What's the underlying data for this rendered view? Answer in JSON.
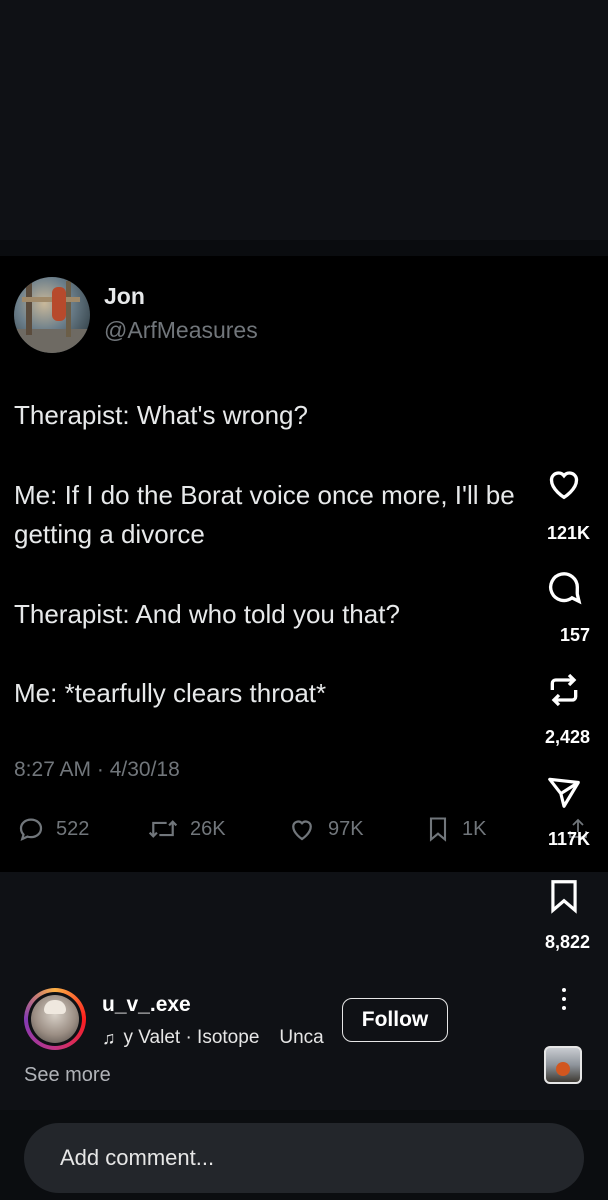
{
  "tweet": {
    "author_name": "Jon",
    "author_handle": "@ArfMeasures",
    "lines": [
      "Therapist: What's wrong?",
      "Me: If I do the Borat voice once more, I'll be",
      "getting a divorce",
      "Therapist: And who told you that?",
      "Me: *tearfully clears throat*"
    ],
    "timestamp": "8:27 AM · 4/30/18",
    "stats": {
      "replies": "522",
      "retweets": "26K",
      "likes": "97K",
      "bookmarks": "1K"
    }
  },
  "rail": {
    "likes": "121K",
    "comments": "157",
    "reposts": "2,428",
    "shares": "117K",
    "saves": "8,822"
  },
  "reel": {
    "username": "u_v_.exe",
    "music": "y Valet · Isotope",
    "music_extra": "Unca",
    "follow_label": "Follow",
    "see_more": "See more"
  },
  "comment": {
    "placeholder": "Add comment..."
  },
  "icons": {
    "like": "heart-icon",
    "comment": "speech-bubble-icon",
    "repost": "repost-icon",
    "share": "send-icon",
    "save": "bookmark-icon",
    "more": "more-vertical-icon",
    "music": "music-note-icon"
  },
  "colors": {
    "background": "#0e1014",
    "tweet_background": "#000000",
    "secondary_text": "#71767b",
    "primary_text": "#e7e9ea"
  }
}
